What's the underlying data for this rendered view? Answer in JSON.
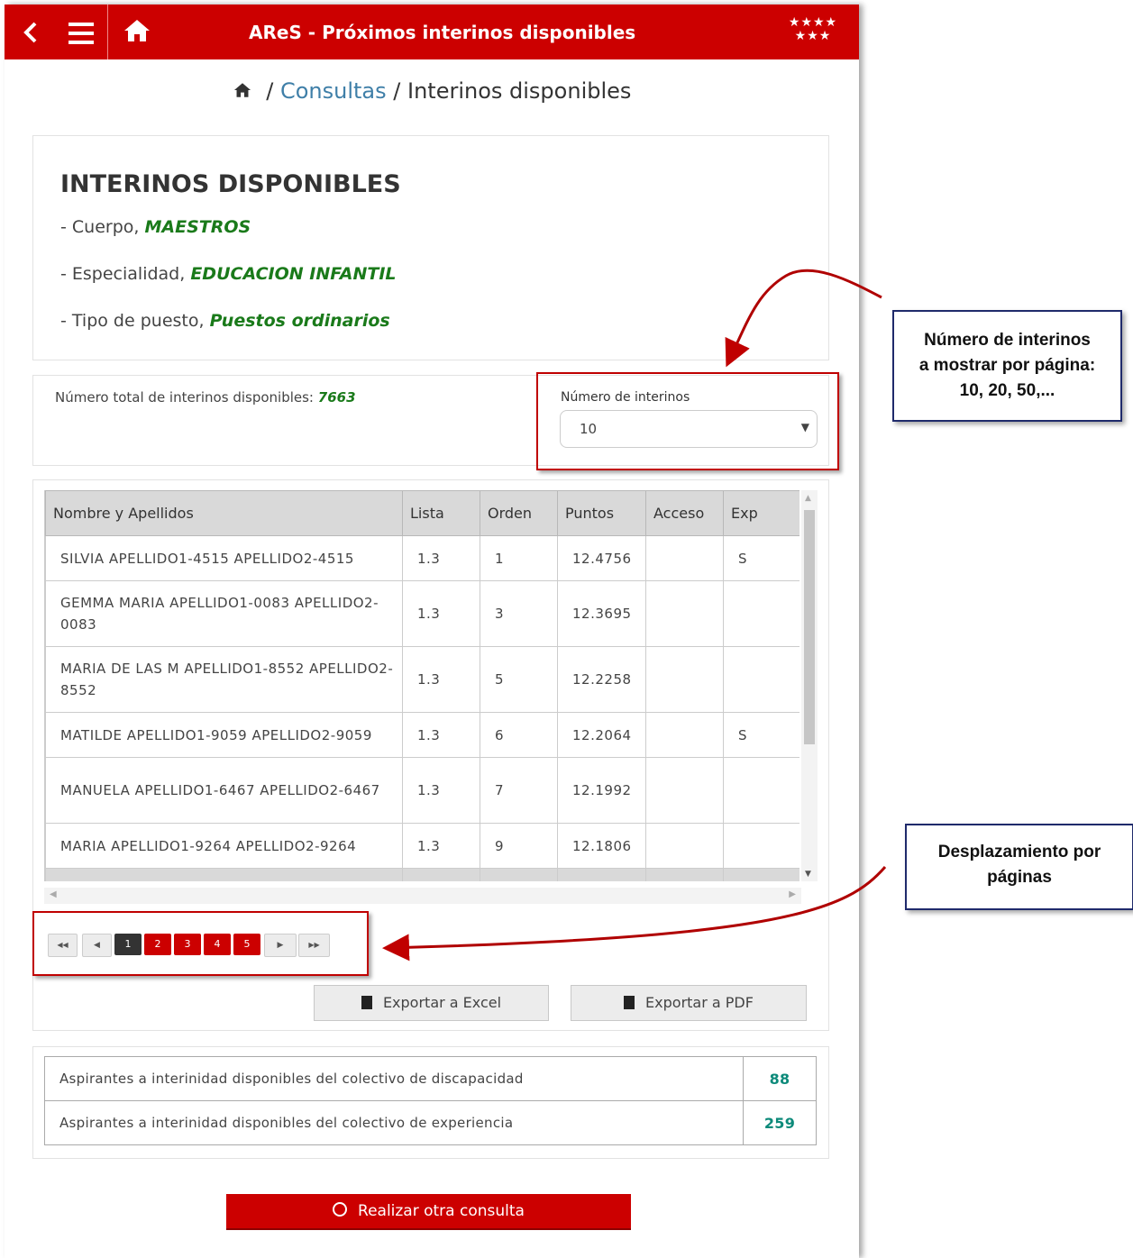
{
  "header": {
    "title": "AReS - Próximos interinos disponibles",
    "stars": "★★★★ ★★★",
    "accent_color": "#cc0000"
  },
  "breadcrumb": {
    "separator": "/",
    "link": "Consultas",
    "current": "Interinos disponibles"
  },
  "info": {
    "heading": "INTERINOS DISPONIBLES",
    "lines": [
      {
        "label": "- Cuerpo, ",
        "value": "MAESTROS"
      },
      {
        "label": "- Especialidad, ",
        "value": "EDUCACION INFANTIL"
      },
      {
        "label": "- Tipo de puesto, ",
        "value": "Puestos ordinarios"
      }
    ]
  },
  "total": {
    "label": "Número total de interinos disponibles: ",
    "value": "7663"
  },
  "per_page": {
    "label": "Número de interinos",
    "selected": "10"
  },
  "table": {
    "columns": [
      "Nombre y Apellidos",
      "Lista",
      "Orden",
      "Puntos",
      "Acceso",
      "Exp"
    ],
    "rows": [
      {
        "name": "SILVIA APELLIDO1-4515 APELLIDO2-4515",
        "lista": "1.3",
        "orden": "1",
        "puntos": "12.4756",
        "acceso": "",
        "exp": "S"
      },
      {
        "name": "GEMMA MARIA APELLIDO1-0083 APELLIDO2-0083",
        "lista": "1.3",
        "orden": "3",
        "puntos": "12.3695",
        "acceso": "",
        "exp": ""
      },
      {
        "name": "MARIA DE LAS M APELLIDO1-8552 APELLIDO2-8552",
        "lista": "1.3",
        "orden": "5",
        "puntos": "12.2258",
        "acceso": "",
        "exp": ""
      },
      {
        "name": "MATILDE APELLIDO1-9059 APELLIDO2-9059",
        "lista": "1.3",
        "orden": "6",
        "puntos": "12.2064",
        "acceso": "",
        "exp": "S"
      },
      {
        "name": "MANUELA APELLIDO1-6467 APELLIDO2-6467",
        "lista": "1.3",
        "orden": "7",
        "puntos": "12.1992",
        "acceso": "",
        "exp": ""
      },
      {
        "name": "MARIA APELLIDO1-9264 APELLIDO2-9264",
        "lista": "1.3",
        "orden": "9",
        "puntos": "12.1806",
        "acceso": "",
        "exp": ""
      }
    ]
  },
  "pagination": {
    "first": "◀◀",
    "prev": "◀",
    "pages": [
      "1",
      "2",
      "3",
      "4",
      "5"
    ],
    "next": "▶",
    "last": "▶▶"
  },
  "export": {
    "excel": "Exportar a Excel",
    "pdf": "Exportar a PDF"
  },
  "stats": [
    {
      "label": "Aspirantes a interinidad disponibles del colectivo de discapacidad",
      "value": "88"
    },
    {
      "label": "Aspirantes a interinidad disponibles del colectivo de experiencia",
      "value": "259"
    }
  ],
  "main_button": "Realizar otra consulta",
  "callouts": {
    "per_page": [
      "Número de interinos",
      "a mostrar por página:",
      "10, 20, 50,..."
    ],
    "paging": [
      "Desplazamiento por",
      "páginas"
    ]
  }
}
